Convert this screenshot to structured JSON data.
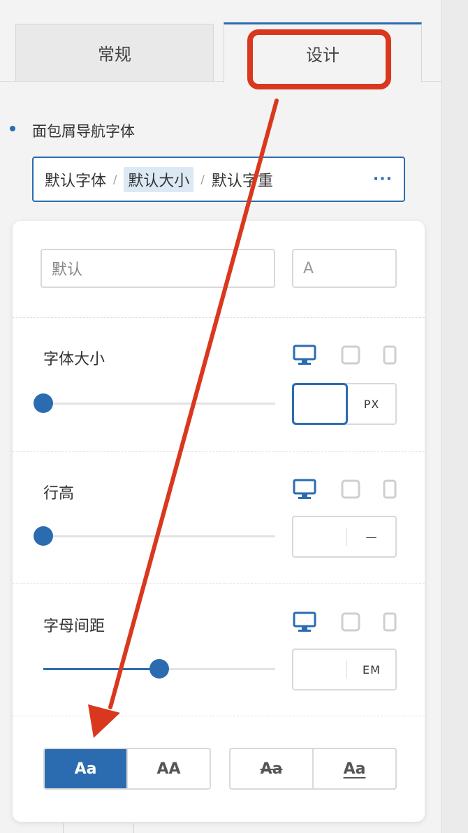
{
  "tabs": [
    {
      "label": "常规",
      "active": false
    },
    {
      "label": "设计",
      "active": true
    }
  ],
  "section": {
    "title": "面包屑导航字体",
    "summary": {
      "family": "默认字体",
      "size": "默认大小",
      "weight": "默认字重",
      "separator": "/",
      "more": "···"
    }
  },
  "font_family_input": {
    "value": "默认"
  },
  "font_preview": {
    "value": "A"
  },
  "font_size": {
    "label": "字体大小",
    "value": "",
    "unit": "PX",
    "slider": 0.0
  },
  "line_height": {
    "label": "行高",
    "value": "",
    "unit": "—",
    "slider": 0.0
  },
  "letter_spacing": {
    "label": "字母间距",
    "value": "",
    "unit": "EM",
    "slider": 0.5
  },
  "text_transform": {
    "options": [
      "Aa",
      "AA"
    ],
    "selected": "Aa"
  },
  "text_decoration": {
    "options": [
      "Aa",
      "Aa"
    ]
  },
  "colors": {
    "accent": "#2b6cb0",
    "annotation": "#d9381e"
  }
}
